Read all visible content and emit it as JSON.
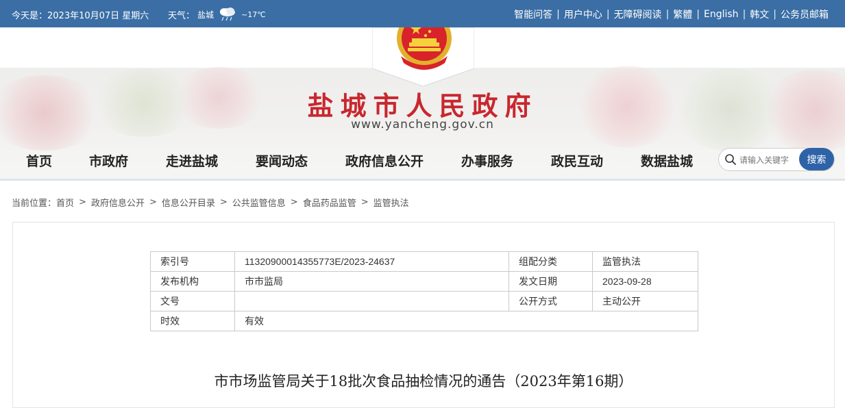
{
  "topbar": {
    "date_text": "今天是：2023年10月07日 星期六",
    "weather_label": "天气：",
    "weather_city": "盐城",
    "weather_temp": "~17℃",
    "weather_icon": "cloud-rain-icon",
    "links": [
      "智能问答",
      "用户中心",
      "无障碍阅读",
      "繁體",
      "English",
      "韩文",
      "公务员邮箱"
    ]
  },
  "header": {
    "emblem": "national-emblem-icon",
    "site_title": "盐城市人民政府",
    "site_url": "www.yancheng.gov.cn"
  },
  "nav": {
    "items": [
      "首页",
      "市政府",
      "走进盐城",
      "要闻动态",
      "政府信息公开",
      "办事服务",
      "政民互动",
      "数据盐城"
    ],
    "search_placeholder": "请输入关键字",
    "search_button": "搜索"
  },
  "breadcrumb": {
    "label": "当前位置：",
    "items": [
      "首页",
      "政府信息公开",
      "信息公开目录",
      "公共监管信息",
      "食品药品监管",
      "监管执法"
    ],
    "separator": ">"
  },
  "meta_table": {
    "rows": [
      [
        "索引号",
        "11320900014355773E/2023-24637",
        "组配分类",
        "监管执法"
      ],
      [
        "发布机构",
        "市市监局",
        "发文日期",
        "2023-09-28"
      ],
      [
        "文号",
        "",
        "公开方式",
        "主动公开"
      ],
      [
        "时效",
        "有效"
      ]
    ]
  },
  "article": {
    "title": "市市场监管局关于18批次食品抽检情况的通告（2023年第16期）"
  },
  "colors": {
    "topbar": "#3a6ea5",
    "title_red": "#c8272e",
    "search_button": "#2f63a8"
  }
}
